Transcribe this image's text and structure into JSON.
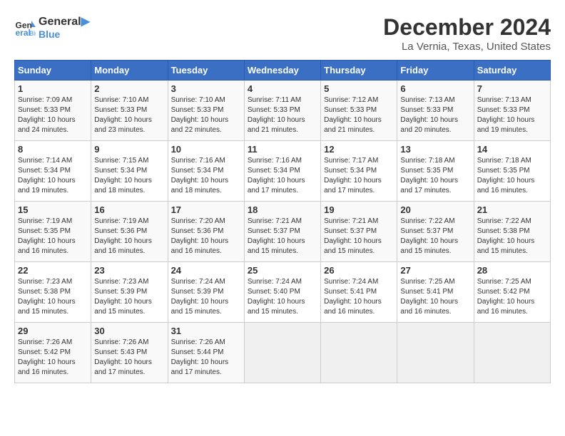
{
  "header": {
    "logo_general": "General",
    "logo_blue": "Blue",
    "month_title": "December 2024",
    "location": "La Vernia, Texas, United States"
  },
  "days_of_week": [
    "Sunday",
    "Monday",
    "Tuesday",
    "Wednesday",
    "Thursday",
    "Friday",
    "Saturday"
  ],
  "weeks": [
    [
      {
        "day": "1",
        "sunrise": "Sunrise: 7:09 AM",
        "sunset": "Sunset: 5:33 PM",
        "daylight": "Daylight: 10 hours and 24 minutes."
      },
      {
        "day": "2",
        "sunrise": "Sunrise: 7:10 AM",
        "sunset": "Sunset: 5:33 PM",
        "daylight": "Daylight: 10 hours and 23 minutes."
      },
      {
        "day": "3",
        "sunrise": "Sunrise: 7:10 AM",
        "sunset": "Sunset: 5:33 PM",
        "daylight": "Daylight: 10 hours and 22 minutes."
      },
      {
        "day": "4",
        "sunrise": "Sunrise: 7:11 AM",
        "sunset": "Sunset: 5:33 PM",
        "daylight": "Daylight: 10 hours and 21 minutes."
      },
      {
        "day": "5",
        "sunrise": "Sunrise: 7:12 AM",
        "sunset": "Sunset: 5:33 PM",
        "daylight": "Daylight: 10 hours and 21 minutes."
      },
      {
        "day": "6",
        "sunrise": "Sunrise: 7:13 AM",
        "sunset": "Sunset: 5:33 PM",
        "daylight": "Daylight: 10 hours and 20 minutes."
      },
      {
        "day": "7",
        "sunrise": "Sunrise: 7:13 AM",
        "sunset": "Sunset: 5:33 PM",
        "daylight": "Daylight: 10 hours and 19 minutes."
      }
    ],
    [
      {
        "day": "8",
        "sunrise": "Sunrise: 7:14 AM",
        "sunset": "Sunset: 5:34 PM",
        "daylight": "Daylight: 10 hours and 19 minutes."
      },
      {
        "day": "9",
        "sunrise": "Sunrise: 7:15 AM",
        "sunset": "Sunset: 5:34 PM",
        "daylight": "Daylight: 10 hours and 18 minutes."
      },
      {
        "day": "10",
        "sunrise": "Sunrise: 7:16 AM",
        "sunset": "Sunset: 5:34 PM",
        "daylight": "Daylight: 10 hours and 18 minutes."
      },
      {
        "day": "11",
        "sunrise": "Sunrise: 7:16 AM",
        "sunset": "Sunset: 5:34 PM",
        "daylight": "Daylight: 10 hours and 17 minutes."
      },
      {
        "day": "12",
        "sunrise": "Sunrise: 7:17 AM",
        "sunset": "Sunset: 5:34 PM",
        "daylight": "Daylight: 10 hours and 17 minutes."
      },
      {
        "day": "13",
        "sunrise": "Sunrise: 7:18 AM",
        "sunset": "Sunset: 5:35 PM",
        "daylight": "Daylight: 10 hours and 17 minutes."
      },
      {
        "day": "14",
        "sunrise": "Sunrise: 7:18 AM",
        "sunset": "Sunset: 5:35 PM",
        "daylight": "Daylight: 10 hours and 16 minutes."
      }
    ],
    [
      {
        "day": "15",
        "sunrise": "Sunrise: 7:19 AM",
        "sunset": "Sunset: 5:35 PM",
        "daylight": "Daylight: 10 hours and 16 minutes."
      },
      {
        "day": "16",
        "sunrise": "Sunrise: 7:19 AM",
        "sunset": "Sunset: 5:36 PM",
        "daylight": "Daylight: 10 hours and 16 minutes."
      },
      {
        "day": "17",
        "sunrise": "Sunrise: 7:20 AM",
        "sunset": "Sunset: 5:36 PM",
        "daylight": "Daylight: 10 hours and 16 minutes."
      },
      {
        "day": "18",
        "sunrise": "Sunrise: 7:21 AM",
        "sunset": "Sunset: 5:37 PM",
        "daylight": "Daylight: 10 hours and 15 minutes."
      },
      {
        "day": "19",
        "sunrise": "Sunrise: 7:21 AM",
        "sunset": "Sunset: 5:37 PM",
        "daylight": "Daylight: 10 hours and 15 minutes."
      },
      {
        "day": "20",
        "sunrise": "Sunrise: 7:22 AM",
        "sunset": "Sunset: 5:37 PM",
        "daylight": "Daylight: 10 hours and 15 minutes."
      },
      {
        "day": "21",
        "sunrise": "Sunrise: 7:22 AM",
        "sunset": "Sunset: 5:38 PM",
        "daylight": "Daylight: 10 hours and 15 minutes."
      }
    ],
    [
      {
        "day": "22",
        "sunrise": "Sunrise: 7:23 AM",
        "sunset": "Sunset: 5:38 PM",
        "daylight": "Daylight: 10 hours and 15 minutes."
      },
      {
        "day": "23",
        "sunrise": "Sunrise: 7:23 AM",
        "sunset": "Sunset: 5:39 PM",
        "daylight": "Daylight: 10 hours and 15 minutes."
      },
      {
        "day": "24",
        "sunrise": "Sunrise: 7:24 AM",
        "sunset": "Sunset: 5:39 PM",
        "daylight": "Daylight: 10 hours and 15 minutes."
      },
      {
        "day": "25",
        "sunrise": "Sunrise: 7:24 AM",
        "sunset": "Sunset: 5:40 PM",
        "daylight": "Daylight: 10 hours and 15 minutes."
      },
      {
        "day": "26",
        "sunrise": "Sunrise: 7:24 AM",
        "sunset": "Sunset: 5:41 PM",
        "daylight": "Daylight: 10 hours and 16 minutes."
      },
      {
        "day": "27",
        "sunrise": "Sunrise: 7:25 AM",
        "sunset": "Sunset: 5:41 PM",
        "daylight": "Daylight: 10 hours and 16 minutes."
      },
      {
        "day": "28",
        "sunrise": "Sunrise: 7:25 AM",
        "sunset": "Sunset: 5:42 PM",
        "daylight": "Daylight: 10 hours and 16 minutes."
      }
    ],
    [
      {
        "day": "29",
        "sunrise": "Sunrise: 7:26 AM",
        "sunset": "Sunset: 5:42 PM",
        "daylight": "Daylight: 10 hours and 16 minutes."
      },
      {
        "day": "30",
        "sunrise": "Sunrise: 7:26 AM",
        "sunset": "Sunset: 5:43 PM",
        "daylight": "Daylight: 10 hours and 17 minutes."
      },
      {
        "day": "31",
        "sunrise": "Sunrise: 7:26 AM",
        "sunset": "Sunset: 5:44 PM",
        "daylight": "Daylight: 10 hours and 17 minutes."
      },
      null,
      null,
      null,
      null
    ]
  ]
}
